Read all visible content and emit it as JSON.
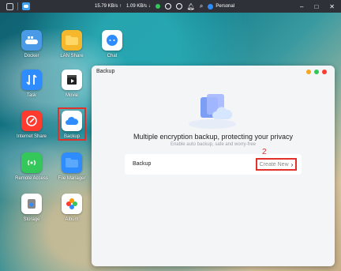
{
  "topbar": {
    "upload_rate": "15.79 KB/s ↑",
    "download_rate": "1.09 KB/s ↓",
    "user": "Personal",
    "controls": [
      "–",
      "□",
      "✕"
    ]
  },
  "desktop_icons": [
    {
      "label": "Docker",
      "icon": "docker-icon",
      "color": "#4a9ae8"
    },
    {
      "label": "LAN Share",
      "icon": "folder-icon",
      "color": "#f5b72c"
    },
    {
      "label": "Chat",
      "icon": "chat-icon",
      "color": "#ffffff"
    },
    {
      "label": "Task",
      "icon": "transfer-icon",
      "color": "#2f8cff"
    },
    {
      "label": "Movie",
      "icon": "clapper-icon",
      "color": "#ffffff"
    },
    {
      "label": "Internet Share",
      "icon": "share-icon",
      "color": "#ff3b30"
    },
    {
      "label": "Backup",
      "icon": "cloud-icon",
      "color": "#ffffff"
    },
    {
      "label": "Remote Access",
      "icon": "wireless-icon",
      "color": "#34c759"
    },
    {
      "label": "File Manager",
      "icon": "folder-blue-icon",
      "color": "#2f8cff"
    },
    {
      "label": "Storage",
      "icon": "storage-icon",
      "color": "#ffffff"
    },
    {
      "label": "Album",
      "icon": "album-icon",
      "color": "#ffffff"
    }
  ],
  "window": {
    "title": "Backup",
    "headline": "Multiple encryption backup, protecting your privacy",
    "subtitle": "Enable auto backup, safe and worry-free",
    "card_label": "Backup",
    "create_button": "Create New",
    "step_marker": "2",
    "lights": [
      "#f5a623",
      "#34c759",
      "#ff3b30"
    ]
  }
}
